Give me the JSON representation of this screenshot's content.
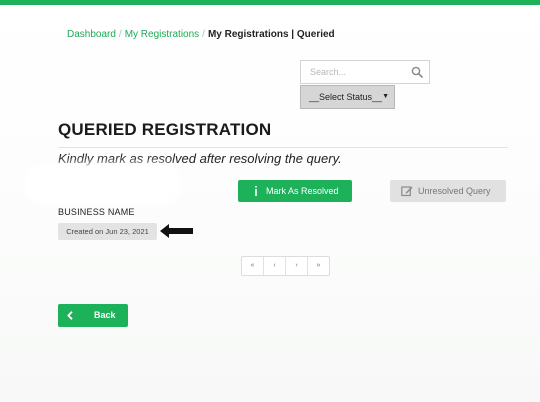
{
  "breadcrumb": {
    "items": [
      "Dashboard",
      "My Registrations"
    ],
    "current": "My Registrations | Queried",
    "separator": "/"
  },
  "search": {
    "placeholder": "Search...",
    "value": ""
  },
  "status_filter": {
    "selected": "__Select Status__"
  },
  "page": {
    "title": "QUERIED REGISTRATION",
    "subtitle": "Kindly mark as resolved after resolving the query."
  },
  "actions": {
    "mark_resolved_label": "Mark As Resolved",
    "unresolved_label": "Unresolved Query"
  },
  "registration": {
    "business_name": "BUSINESS NAME",
    "created": "Created on Jun 23, 2021"
  },
  "pagination": {
    "first": "«",
    "prev": "‹",
    "next": "›",
    "last": "»"
  },
  "back_label": "Back",
  "colors": {
    "accent": "#1db15a",
    "disabled": "#e1e1e1"
  }
}
